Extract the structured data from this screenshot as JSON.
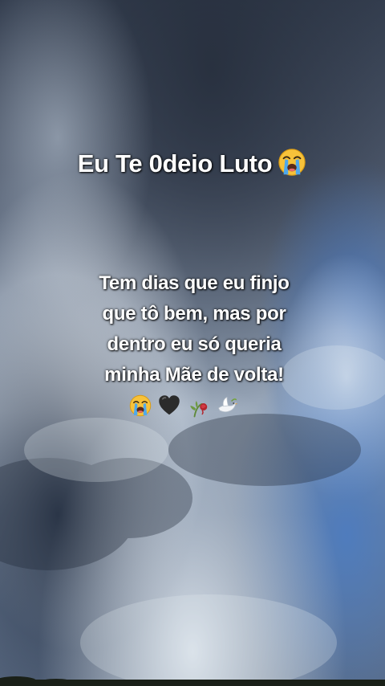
{
  "overlay": {
    "title": "Eu Te 0deio Luto",
    "title_emoji": "loudly-crying-face-emoji",
    "caption_lines": [
      "Tem dias que eu finjo",
      "que tô bem, mas por",
      "dentro eu só queria",
      "minha Mãe de volta!"
    ],
    "emoji_row": [
      "loudly-crying-face-emoji",
      "black-heart-emoji",
      "wilted-rose-emoji",
      "dove-emoji"
    ]
  },
  "colors": {
    "sky_dark": "#2f394a",
    "sky_mid": "#6f7f96",
    "sky_light": "#c8d2de",
    "sky_blue": "#4f78b8",
    "text": "#ffffff"
  }
}
